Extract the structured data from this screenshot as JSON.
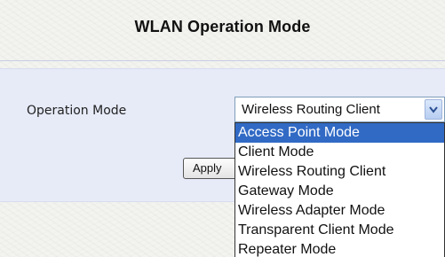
{
  "page": {
    "title": "WLAN Operation Mode"
  },
  "form": {
    "operation_mode_label": "Operation Mode",
    "operation_mode_value": "Wireless Routing Client",
    "apply_label": "Apply",
    "operation_mode_options": [
      "Access Point Mode",
      "Client Mode",
      "Wireless Routing Client",
      "Gateway Mode",
      "Wireless Adapter Mode",
      "Transparent Client Mode",
      "Repeater Mode"
    ],
    "highlighted_option": "Access Point Mode"
  },
  "icons": {
    "dropdown_arrow": "chevron-down-icon"
  },
  "colors": {
    "panel_background": "#e7ebf8",
    "highlight": "#316ac5"
  }
}
